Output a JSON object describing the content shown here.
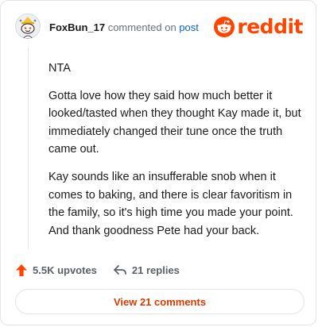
{
  "comment": {
    "username": "FoxBun_17",
    "commented_on": "commented on",
    "post_link": "post",
    "paragraphs": [
      "NTA",
      "Gotta love how they said how much better it looked/tasted when they thought Kay made it, but immediately changed their tune once the truth came out.",
      "Kay sounds like an insufferable snob when it comes to baking, and there is clear favoritism in the family, so it's high time you made your point. And thank goodness Pete had your back."
    ]
  },
  "brand": {
    "wordmark": "reddit",
    "color": "#ff4500",
    "icon": "reddit-snoo-icon"
  },
  "actions": {
    "upvotes": "5.5K upvotes",
    "replies": "21 replies",
    "upvote_icon": "upvote-arrow-icon",
    "reply_icon": "reply-arrow-icon",
    "upvote_color": "#ff4500"
  },
  "footer": {
    "view_comments": "View 21 comments"
  }
}
